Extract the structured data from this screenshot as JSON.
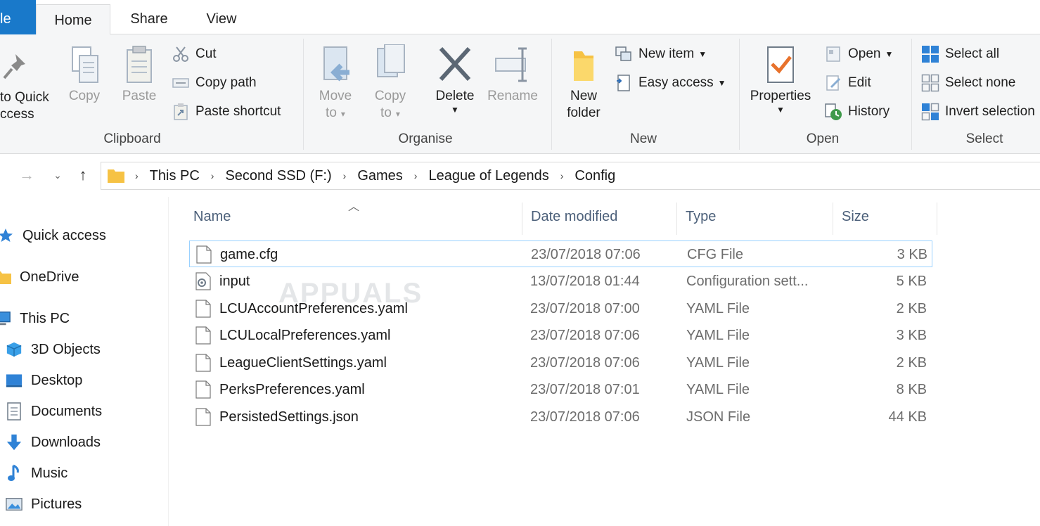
{
  "tabs": {
    "file": "le",
    "home": "Home",
    "share": "Share",
    "view": "View"
  },
  "ribbon": {
    "clipboard": {
      "label": "Clipboard",
      "pin_line1": "to Quick",
      "pin_line2": "ccess",
      "copy": "Copy",
      "paste": "Paste",
      "cut": "Cut",
      "copy_path": "Copy path",
      "paste_shortcut": "Paste shortcut"
    },
    "organise": {
      "label": "Organise",
      "move_line1": "Move",
      "move_line2": "to",
      "copy_line1": "Copy",
      "copy_line2": "to",
      "delete": "Delete",
      "rename": "Rename"
    },
    "new": {
      "label": "New",
      "folder_line1": "New",
      "folder_line2": "folder",
      "new_item": "New item",
      "easy_access": "Easy access"
    },
    "open": {
      "label": "Open",
      "properties": "Properties",
      "open": "Open",
      "edit": "Edit",
      "history": "History"
    },
    "select": {
      "label": "Select",
      "select_all": "Select all",
      "select_none": "Select none",
      "invert": "Invert selection"
    }
  },
  "breadcrumb": [
    "This PC",
    "Second SSD (F:)",
    "Games",
    "League of Legends",
    "Config"
  ],
  "navpane": {
    "quick_access": "Quick access",
    "onedrive": "OneDrive",
    "this_pc": "This PC",
    "objects3d": "3D Objects",
    "desktop": "Desktop",
    "documents": "Documents",
    "downloads": "Downloads",
    "music": "Music",
    "pictures": "Pictures"
  },
  "columns": {
    "name": "Name",
    "date": "Date modified",
    "type": "Type",
    "size": "Size"
  },
  "files": [
    {
      "name": "game.cfg",
      "date": "23/07/2018 07:06",
      "type": "CFG File",
      "size": "3 KB"
    },
    {
      "name": "input",
      "date": "13/07/2018 01:44",
      "type": "Configuration sett...",
      "size": "5 KB"
    },
    {
      "name": "LCUAccountPreferences.yaml",
      "date": "23/07/2018 07:00",
      "type": "YAML File",
      "size": "2 KB"
    },
    {
      "name": "LCULocalPreferences.yaml",
      "date": "23/07/2018 07:06",
      "type": "YAML File",
      "size": "3 KB"
    },
    {
      "name": "LeagueClientSettings.yaml",
      "date": "23/07/2018 07:06",
      "type": "YAML File",
      "size": "2 KB"
    },
    {
      "name": "PerksPreferences.yaml",
      "date": "23/07/2018 07:01",
      "type": "YAML File",
      "size": "8 KB"
    },
    {
      "name": "PersistedSettings.json",
      "date": "23/07/2018 07:06",
      "type": "JSON File",
      "size": "44 KB"
    }
  ],
  "watermark": "APPUALS",
  "colors": {
    "accent": "#1979ca",
    "selection_border": "#99d1ff",
    "folder": "#f6c244"
  }
}
